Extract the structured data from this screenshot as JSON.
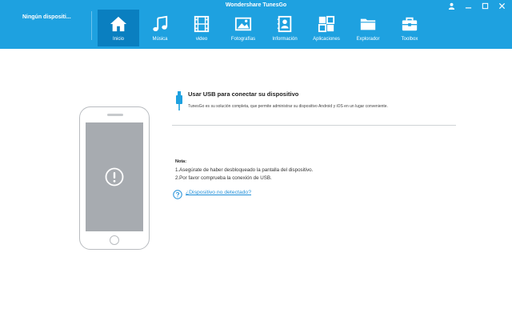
{
  "window": {
    "title": "Wondershare TunesGo",
    "controls": [
      "user-icon",
      "minimize-icon",
      "maximize-icon",
      "close-icon"
    ]
  },
  "device": {
    "name": "Ningún dispositi..."
  },
  "nav": {
    "items": [
      {
        "label": "Inicio",
        "icon": "home-icon",
        "active": true
      },
      {
        "label": "Música",
        "icon": "music-icon",
        "active": false
      },
      {
        "label": "video",
        "icon": "film-icon",
        "active": false
      },
      {
        "label": "Fotografías",
        "icon": "photo-icon",
        "active": false
      },
      {
        "label": "Información",
        "icon": "contacts-icon",
        "active": false
      },
      {
        "label": "Aplicaciones",
        "icon": "apps-icon",
        "active": false
      },
      {
        "label": "Explorador",
        "icon": "folder-icon",
        "active": false
      },
      {
        "label": "Toolbox",
        "icon": "toolbox-icon",
        "active": false
      }
    ]
  },
  "main": {
    "heading": "Usar USB para conectar su dispositivo",
    "description": "TunesGo es su solución completa, que permite administrar su dispositivo Android y iOS en un lugar conveniente.",
    "note_title": "Nota:",
    "note_lines": [
      "1.Asegúrate de haber desbloqueado la pantalla del dispositivo.",
      "2.Por favor comprueba la conexión de USB."
    ],
    "help_link": "¿Dispositivo no detectado?"
  },
  "colors": {
    "header": "#1ea1e0",
    "active_tab": "#0a7fc0",
    "link": "#1e8ed8",
    "phone_screen": "#a7abb0"
  }
}
